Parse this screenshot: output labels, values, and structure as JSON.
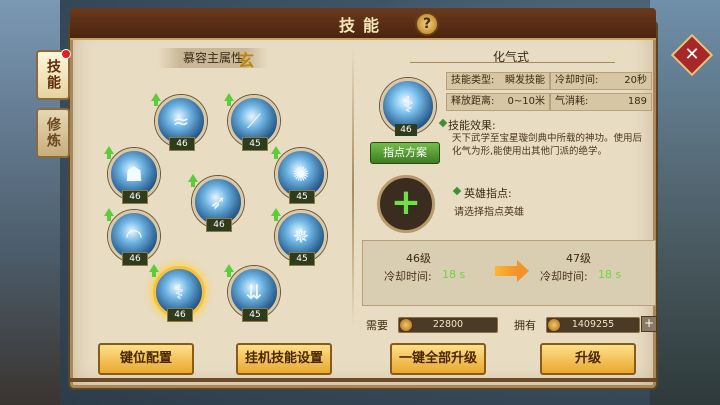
{
  "window": {
    "title": "技能",
    "help_icon": "?"
  },
  "tabs": [
    {
      "label": "技能",
      "active": true,
      "notice": true
    },
    {
      "label": "修炼",
      "active": false
    }
  ],
  "close_icon": "✕",
  "attribute": {
    "label": "慕容主属性",
    "value": "玄"
  },
  "skills": [
    {
      "level": "46",
      "glyph": "≈",
      "upgradable": true,
      "selected": false
    },
    {
      "level": "45",
      "glyph": "⟋",
      "upgradable": true,
      "selected": false
    },
    {
      "level": "46",
      "glyph": "☗",
      "upgradable": true,
      "selected": false
    },
    {
      "level": "45",
      "glyph": "✺",
      "upgradable": true,
      "selected": false
    },
    {
      "level": "46",
      "glyph": "➶",
      "upgradable": true,
      "selected": false
    },
    {
      "level": "46",
      "glyph": "◠",
      "upgradable": true,
      "selected": false
    },
    {
      "level": "45",
      "glyph": "✵",
      "upgradable": true,
      "selected": false
    },
    {
      "level": "46",
      "glyph": "⚕",
      "upgradable": true,
      "selected": true
    },
    {
      "level": "45",
      "glyph": "⇊",
      "upgradable": true,
      "selected": false
    }
  ],
  "buttons": {
    "key_config": "键位配置",
    "auto_skill": "挂机技能设置",
    "upgrade_all": "一键全部升级",
    "upgrade": "升级"
  },
  "detail": {
    "name": "化气式",
    "level": "46",
    "plan_button": "指点方案",
    "type_label": "技能类型:",
    "type_value": "瞬发技能",
    "cooldown_label": "冷却时间:",
    "cooldown_value": "20秒",
    "range_label": "释放距离:",
    "range_value": "0~10米",
    "qi_label": "气消耗:",
    "qi_value": "189",
    "effect_title": "技能效果:",
    "effect_text": "天下武学至宝星璇剑典中所载的神功。使用后化气为形,能使用出其他门派的绝学。",
    "hero_title": "英雄指点:",
    "hero_text": "请选择指点英雄"
  },
  "level_compare": {
    "current_level": "46级",
    "next_level": "47级",
    "cooldown_label": "冷却时间:",
    "current_value": "18 s",
    "next_value": "18 s"
  },
  "cost": {
    "need_label": "需要",
    "need_value": "22800",
    "have_label": "拥有",
    "have_value": "1409255",
    "add_icon": "+"
  }
}
